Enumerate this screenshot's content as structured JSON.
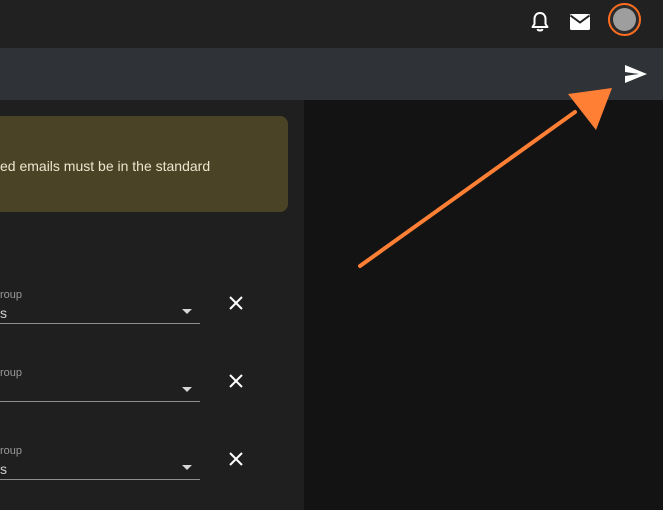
{
  "header": {
    "icons": [
      "bell-icon",
      "mail-icon",
      "avatar"
    ],
    "accent_color": "#ff6d1f"
  },
  "toolbar": {
    "send_icon": "send-icon"
  },
  "notice": {
    "text": "ed emails must be in the standard"
  },
  "group_rows": [
    {
      "label": "roup",
      "value": "s",
      "value_state": "filled"
    },
    {
      "label": "roup",
      "value": "",
      "value_state": "placeholder"
    },
    {
      "label": "roup",
      "value": "s",
      "value_state": "filled"
    }
  ],
  "annotation": {
    "color": "#ff7f35",
    "points_to": "send-icon"
  }
}
